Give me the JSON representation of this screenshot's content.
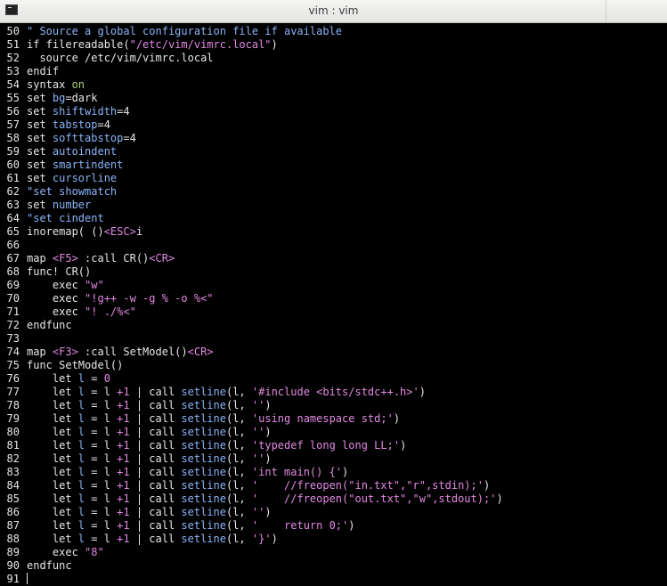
{
  "window": {
    "title": "vim : vim"
  },
  "colors": {
    "background": "#000000",
    "foreground": "#e6e6e6",
    "keyword": "#e6e6e6",
    "string": "#e388e3",
    "comment": "#8ab4f8",
    "option": "#8ab4f8",
    "value": "#a7d27a"
  },
  "lines": [
    {
      "n": "50",
      "segs": [
        [
          "\" Source a global configuration file if available",
          "comment"
        ]
      ]
    },
    {
      "n": "51",
      "segs": [
        [
          "if filereadable(",
          "keyword"
        ],
        [
          "\"/etc/vim/vimrc.local\"",
          "string"
        ],
        [
          ")",
          "keyword"
        ]
      ]
    },
    {
      "n": "52",
      "segs": [
        [
          "  source /etc/vim/vimrc.local",
          "keyword"
        ]
      ]
    },
    {
      "n": "53",
      "segs": [
        [
          "endif",
          "keyword"
        ]
      ]
    },
    {
      "n": "54",
      "segs": [
        [
          "syntax ",
          "keyword"
        ],
        [
          "on",
          "value"
        ]
      ]
    },
    {
      "n": "55",
      "segs": [
        [
          "set ",
          "keyword"
        ],
        [
          "bg",
          "option"
        ],
        [
          "=dark",
          "keyword"
        ]
      ]
    },
    {
      "n": "56",
      "segs": [
        [
          "set ",
          "keyword"
        ],
        [
          "shiftwidth",
          "option"
        ],
        [
          "=4",
          "keyword"
        ]
      ]
    },
    {
      "n": "57",
      "segs": [
        [
          "set ",
          "keyword"
        ],
        [
          "tabstop",
          "option"
        ],
        [
          "=4",
          "keyword"
        ]
      ]
    },
    {
      "n": "58",
      "segs": [
        [
          "set ",
          "keyword"
        ],
        [
          "softtabstop",
          "option"
        ],
        [
          "=4",
          "keyword"
        ]
      ]
    },
    {
      "n": "59",
      "segs": [
        [
          "set ",
          "keyword"
        ],
        [
          "autoindent",
          "option"
        ]
      ]
    },
    {
      "n": "60",
      "segs": [
        [
          "set ",
          "keyword"
        ],
        [
          "smartindent",
          "option"
        ]
      ]
    },
    {
      "n": "61",
      "segs": [
        [
          "set ",
          "keyword"
        ],
        [
          "cursorline",
          "option"
        ]
      ]
    },
    {
      "n": "62",
      "segs": [
        [
          "\"set showmatch",
          "comment"
        ]
      ]
    },
    {
      "n": "63",
      "segs": [
        [
          "set ",
          "keyword"
        ],
        [
          "number",
          "option"
        ]
      ]
    },
    {
      "n": "64",
      "segs": [
        [
          "\"set cindent",
          "comment"
        ]
      ]
    },
    {
      "n": "65",
      "segs": [
        [
          "inoremap( ()",
          "keyword"
        ],
        [
          "<ESC>",
          "string"
        ],
        [
          "i",
          "keyword"
        ]
      ]
    },
    {
      "n": "66",
      "segs": []
    },
    {
      "n": "67",
      "segs": [
        [
          "map ",
          "keyword"
        ],
        [
          "<F5>",
          "string"
        ],
        [
          " :call CR()",
          "keyword"
        ],
        [
          "<CR>",
          "string"
        ]
      ]
    },
    {
      "n": "68",
      "segs": [
        [
          "func! CR()",
          "keyword"
        ]
      ]
    },
    {
      "n": "69",
      "segs": [
        [
          "    exec ",
          "keyword"
        ],
        [
          "\"w\"",
          "string"
        ]
      ]
    },
    {
      "n": "70",
      "segs": [
        [
          "    exec ",
          "keyword"
        ],
        [
          "\"!g++ -w -g % -o %<\"",
          "string"
        ]
      ]
    },
    {
      "n": "71",
      "segs": [
        [
          "    exec ",
          "keyword"
        ],
        [
          "\"! ./%<\"",
          "string"
        ]
      ]
    },
    {
      "n": "72",
      "segs": [
        [
          "endfunc",
          "keyword"
        ]
      ]
    },
    {
      "n": "73",
      "segs": []
    },
    {
      "n": "74",
      "segs": [
        [
          "map ",
          "keyword"
        ],
        [
          "<F3>",
          "string"
        ],
        [
          " :call SetModel()",
          "keyword"
        ],
        [
          "<CR>",
          "string"
        ]
      ]
    },
    {
      "n": "75",
      "segs": [
        [
          "func SetModel()",
          "keyword"
        ]
      ]
    },
    {
      "n": "76",
      "segs": [
        [
          "    let ",
          "keyword"
        ],
        [
          "l",
          "option"
        ],
        [
          " = ",
          "keyword"
        ],
        [
          "0",
          "string"
        ]
      ]
    },
    {
      "n": "77",
      "segs": [
        [
          "    let ",
          "keyword"
        ],
        [
          "l",
          "option"
        ],
        [
          " = l ",
          "keyword"
        ],
        [
          "+1",
          "string"
        ],
        [
          " | call ",
          "keyword"
        ],
        [
          "setline",
          "option"
        ],
        [
          "(l, ",
          "keyword"
        ],
        [
          "'#include <bits/stdc++.h>'",
          "string"
        ],
        [
          ")",
          "keyword"
        ]
      ]
    },
    {
      "n": "78",
      "segs": [
        [
          "    let ",
          "keyword"
        ],
        [
          "l",
          "option"
        ],
        [
          " = l ",
          "keyword"
        ],
        [
          "+1",
          "string"
        ],
        [
          " | call ",
          "keyword"
        ],
        [
          "setline",
          "option"
        ],
        [
          "(l, ",
          "keyword"
        ],
        [
          "''",
          "string"
        ],
        [
          ")",
          "keyword"
        ]
      ]
    },
    {
      "n": "79",
      "segs": [
        [
          "    let ",
          "keyword"
        ],
        [
          "l",
          "option"
        ],
        [
          " = l ",
          "keyword"
        ],
        [
          "+1",
          "string"
        ],
        [
          " | call ",
          "keyword"
        ],
        [
          "setline",
          "option"
        ],
        [
          "(l, ",
          "keyword"
        ],
        [
          "'using namespace std;'",
          "string"
        ],
        [
          ")",
          "keyword"
        ]
      ]
    },
    {
      "n": "80",
      "segs": [
        [
          "    let ",
          "keyword"
        ],
        [
          "l",
          "option"
        ],
        [
          " = l ",
          "keyword"
        ],
        [
          "+1",
          "string"
        ],
        [
          " | call ",
          "keyword"
        ],
        [
          "setline",
          "option"
        ],
        [
          "(l, ",
          "keyword"
        ],
        [
          "''",
          "string"
        ],
        [
          ")",
          "keyword"
        ]
      ]
    },
    {
      "n": "81",
      "segs": [
        [
          "    let ",
          "keyword"
        ],
        [
          "l",
          "option"
        ],
        [
          " = l ",
          "keyword"
        ],
        [
          "+1",
          "string"
        ],
        [
          " | call ",
          "keyword"
        ],
        [
          "setline",
          "option"
        ],
        [
          "(l, ",
          "keyword"
        ],
        [
          "'typedef long long LL;'",
          "string"
        ],
        [
          ")",
          "keyword"
        ]
      ]
    },
    {
      "n": "82",
      "segs": [
        [
          "    let ",
          "keyword"
        ],
        [
          "l",
          "option"
        ],
        [
          " = l ",
          "keyword"
        ],
        [
          "+1",
          "string"
        ],
        [
          " | call ",
          "keyword"
        ],
        [
          "setline",
          "option"
        ],
        [
          "(l, ",
          "keyword"
        ],
        [
          "''",
          "string"
        ],
        [
          ")",
          "keyword"
        ]
      ]
    },
    {
      "n": "83",
      "segs": [
        [
          "    let ",
          "keyword"
        ],
        [
          "l",
          "option"
        ],
        [
          " = l ",
          "keyword"
        ],
        [
          "+1",
          "string"
        ],
        [
          " | call ",
          "keyword"
        ],
        [
          "setline",
          "option"
        ],
        [
          "(l, ",
          "keyword"
        ],
        [
          "'int main() {'",
          "string"
        ],
        [
          ")",
          "keyword"
        ]
      ]
    },
    {
      "n": "84",
      "segs": [
        [
          "    let ",
          "keyword"
        ],
        [
          "l",
          "option"
        ],
        [
          " = l ",
          "keyword"
        ],
        [
          "+1",
          "string"
        ],
        [
          " | call ",
          "keyword"
        ],
        [
          "setline",
          "option"
        ],
        [
          "(l, ",
          "keyword"
        ],
        [
          "'    //freopen(\"in.txt\",\"r\",stdin);'",
          "string"
        ],
        [
          ")",
          "keyword"
        ]
      ]
    },
    {
      "n": "85",
      "segs": [
        [
          "    let ",
          "keyword"
        ],
        [
          "l",
          "option"
        ],
        [
          " = l ",
          "keyword"
        ],
        [
          "+1",
          "string"
        ],
        [
          " | call ",
          "keyword"
        ],
        [
          "setline",
          "option"
        ],
        [
          "(l, ",
          "keyword"
        ],
        [
          "'    //freopen(\"out.txt\",\"w\",stdout);'",
          "string"
        ],
        [
          ")",
          "keyword"
        ]
      ]
    },
    {
      "n": "86",
      "segs": [
        [
          "    let ",
          "keyword"
        ],
        [
          "l",
          "option"
        ],
        [
          " = l ",
          "keyword"
        ],
        [
          "+1",
          "string"
        ],
        [
          " | call ",
          "keyword"
        ],
        [
          "setline",
          "option"
        ],
        [
          "(l, ",
          "keyword"
        ],
        [
          "''",
          "string"
        ],
        [
          ")",
          "keyword"
        ]
      ]
    },
    {
      "n": "87",
      "segs": [
        [
          "    let ",
          "keyword"
        ],
        [
          "l",
          "option"
        ],
        [
          " = l ",
          "keyword"
        ],
        [
          "+1",
          "string"
        ],
        [
          " | call ",
          "keyword"
        ],
        [
          "setline",
          "option"
        ],
        [
          "(l, ",
          "keyword"
        ],
        [
          "'    return 0;'",
          "string"
        ],
        [
          ")",
          "keyword"
        ]
      ]
    },
    {
      "n": "88",
      "segs": [
        [
          "    let ",
          "keyword"
        ],
        [
          "l",
          "option"
        ],
        [
          " = l ",
          "keyword"
        ],
        [
          "+1",
          "string"
        ],
        [
          " | call ",
          "keyword"
        ],
        [
          "setline",
          "option"
        ],
        [
          "(l, ",
          "keyword"
        ],
        [
          "'}'",
          "string"
        ],
        [
          ")",
          "keyword"
        ]
      ]
    },
    {
      "n": "89",
      "segs": [
        [
          "    exec ",
          "keyword"
        ],
        [
          "\"8\"",
          "string"
        ]
      ]
    },
    {
      "n": "90",
      "segs": [
        [
          "endfunc",
          "keyword"
        ]
      ]
    },
    {
      "n": "91",
      "segs": [],
      "cursor": true
    }
  ]
}
